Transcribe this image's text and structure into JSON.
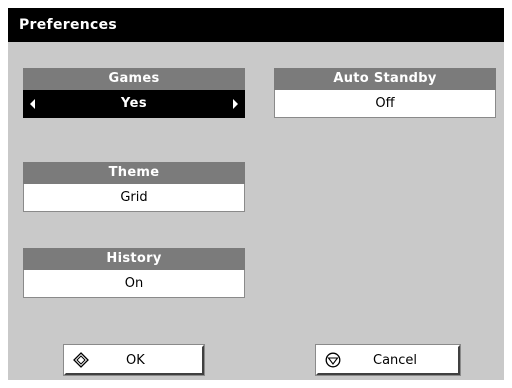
{
  "window": {
    "title": "Preferences"
  },
  "settings": {
    "games": {
      "label": "Games",
      "value": "Yes"
    },
    "auto_standby": {
      "label": "Auto Standby",
      "value": "Off"
    },
    "theme": {
      "label": "Theme",
      "value": "Grid"
    },
    "history": {
      "label": "History",
      "value": "On"
    }
  },
  "buttons": {
    "ok": {
      "label": "OK",
      "icon": "diamond-icon"
    },
    "cancel": {
      "label": "Cancel",
      "icon": "circle-triangle-icon"
    }
  },
  "colors": {
    "titlebar": "#000000",
    "panel": "#c9c9c9",
    "setting_header": "#7b7b7b",
    "selected_value": "#000000"
  }
}
